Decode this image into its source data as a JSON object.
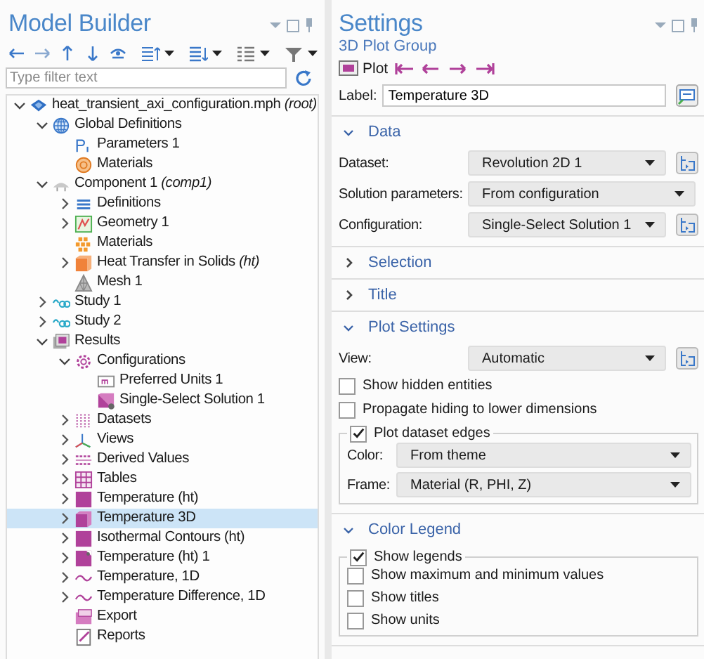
{
  "model_builder": {
    "title": "Model Builder",
    "filter": {
      "placeholder": "Type filter text"
    },
    "tree": [
      {
        "label": "heat_transient_axi_configuration.mph *(root)*",
        "kind": "model",
        "expanded": true,
        "selected": false,
        "children": [
          {
            "label": "Global Definitions",
            "kind": "globe",
            "expanded": true,
            "selected": false,
            "children": [
              {
                "label": "Parameters 1",
                "kind": "parameters",
                "selected": false
              },
              {
                "label": "Materials",
                "kind": "globalmaterial",
                "selected": false
              }
            ]
          },
          {
            "label": "Component 1 *(comp1)*",
            "kind": "component",
            "expanded": true,
            "selected": false,
            "children": [
              {
                "label": "Definitions",
                "kind": "definitions",
                "expanded": false,
                "selected": false
              },
              {
                "label": "Geometry 1",
                "kind": "geometry",
                "expanded": false,
                "selected": false
              },
              {
                "label": "Materials",
                "kind": "materials",
                "selected": false
              },
              {
                "label": "Heat Transfer in Solids *(ht)*",
                "kind": "physics",
                "expanded": false,
                "selected": false
              },
              {
                "label": "Mesh 1",
                "kind": "mesh",
                "selected": false
              }
            ]
          },
          {
            "label": "Study 1",
            "kind": "study",
            "expanded": false,
            "selected": false
          },
          {
            "label": "Study 2",
            "kind": "study",
            "expanded": false,
            "selected": false
          },
          {
            "label": "Results",
            "kind": "results",
            "expanded": true,
            "selected": false,
            "children": [
              {
                "label": "Configurations",
                "kind": "configurations",
                "expanded": true,
                "selected": false,
                "children": [
                  {
                    "label": "Preferred Units 1",
                    "kind": "units",
                    "selected": false
                  },
                  {
                    "label": "Single-Select Solution 1",
                    "kind": "solution",
                    "selected": false
                  }
                ]
              },
              {
                "label": "Datasets",
                "kind": "datasets",
                "expanded": false,
                "selected": false
              },
              {
                "label": "Views",
                "kind": "views",
                "expanded": false,
                "selected": false
              },
              {
                "label": "Derived Values",
                "kind": "derived",
                "expanded": false,
                "selected": false
              },
              {
                "label": "Tables",
                "kind": "tables",
                "expanded": false,
                "selected": false
              },
              {
                "label": "Temperature (ht)",
                "kind": "plot2d",
                "expanded": false,
                "selected": false
              },
              {
                "label": "Temperature 3D",
                "kind": "plot3d",
                "expanded": false,
                "selected": true
              },
              {
                "label": "Isothermal Contours (ht)",
                "kind": "plot2d",
                "expanded": false,
                "selected": false
              },
              {
                "label": "Temperature (ht) 1",
                "kind": "plot2dcorner",
                "expanded": false,
                "selected": false
              },
              {
                "label": "Temperature, 1D",
                "kind": "plot1d",
                "expanded": false,
                "selected": false
              },
              {
                "label": "Temperature Difference, 1D",
                "kind": "plot1d",
                "expanded": false,
                "selected": false
              },
              {
                "label": "Export",
                "kind": "export",
                "selected": false
              },
              {
                "label": "Reports",
                "kind": "reports",
                "selected": false
              }
            ]
          }
        ]
      }
    ]
  },
  "settings": {
    "title": "Settings",
    "subtitle": "3D Plot Group",
    "plot_button": "Plot",
    "label_field": {
      "label": "Label:",
      "value": "Temperature 3D"
    },
    "sections": [
      {
        "title": "Data",
        "expanded": true,
        "rows": [
          {
            "kind": "combo",
            "label": "Dataset:",
            "value": "Revolution 2D 1",
            "has_button": true
          },
          {
            "kind": "combo",
            "label": "Solution parameters:",
            "value": "From configuration",
            "has_button": false
          },
          {
            "kind": "combo",
            "label": "Configuration:",
            "value": "Single-Select Solution 1",
            "has_button": true
          }
        ]
      },
      {
        "title": "Selection",
        "expanded": false
      },
      {
        "title": "Title",
        "expanded": false
      },
      {
        "title": "Plot Settings",
        "expanded": true,
        "rows": [
          {
            "kind": "combo",
            "label": "View:",
            "value": "Automatic",
            "has_button": true
          },
          {
            "kind": "checkbox",
            "label": "Show hidden entities",
            "checked": false
          },
          {
            "kind": "checkbox",
            "label": "Propagate hiding to lower dimensions",
            "checked": false
          },
          {
            "kind": "group",
            "label": "Plot dataset edges",
            "checked": true,
            "rows": [
              {
                "kind": "combo",
                "label": "Color:",
                "value": "From theme",
                "has_button": false
              },
              {
                "kind": "combo",
                "label": "Frame:",
                "value": "Material  (R, PHI, Z)",
                "has_button": false
              }
            ]
          }
        ]
      },
      {
        "title": "Color Legend",
        "expanded": true,
        "rows": [
          {
            "kind": "group",
            "label": "Show legends",
            "checked": true,
            "rows": [
              {
                "kind": "checkbox",
                "label": "Show maximum and minimum values",
                "checked": false
              },
              {
                "kind": "checkbox",
                "label": "Show titles",
                "checked": false
              },
              {
                "kind": "checkbox",
                "label": "Show units",
                "checked": false
              }
            ]
          }
        ]
      }
    ]
  }
}
